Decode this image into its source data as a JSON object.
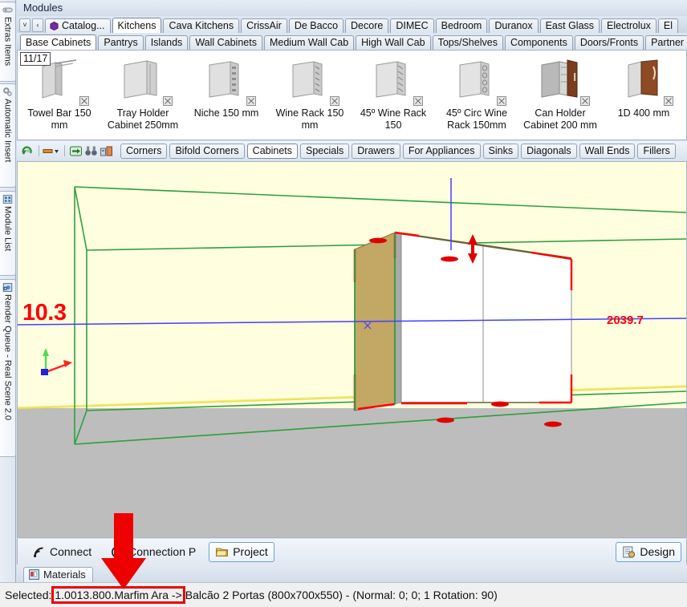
{
  "window": {
    "title": "Modules"
  },
  "left_dock": {
    "items": [
      {
        "label": "Extras Items",
        "icon": "capsule-icon"
      },
      {
        "label": "Automatic Insert",
        "icon": "gears-icon"
      },
      {
        "label": "Module List",
        "icon": "list-icon"
      },
      {
        "label": "Render Queue - Real Scene 2.0",
        "icon": "render-icon"
      }
    ]
  },
  "brand_tabs": {
    "nav_down": "˅",
    "nav_left": "‹",
    "catalog_label": "Catalog...",
    "items": [
      {
        "label": "Kitchens",
        "active": true
      },
      {
        "label": "Cava Kitchens",
        "active": false
      },
      {
        "label": "CrissAir",
        "active": false
      },
      {
        "label": "De Bacco",
        "active": false
      },
      {
        "label": "Decore",
        "active": false
      },
      {
        "label": "DIMEC",
        "active": false
      },
      {
        "label": "Bedroom",
        "active": false
      },
      {
        "label": "Duranox",
        "active": false
      },
      {
        "label": "East Glass",
        "active": false
      },
      {
        "label": "Electrolux",
        "active": false
      },
      {
        "label": "El",
        "active": false
      }
    ]
  },
  "category_tabs": {
    "items": [
      {
        "label": "Base Cabinets",
        "active": true
      },
      {
        "label": "Pantrys",
        "active": false
      },
      {
        "label": "Islands",
        "active": false
      },
      {
        "label": "Wall Cabinets",
        "active": false
      },
      {
        "label": "Medium Wall Cab",
        "active": false
      },
      {
        "label": "High Wall Cab",
        "active": false
      },
      {
        "label": "Tops/Shelves",
        "active": false
      },
      {
        "label": "Components",
        "active": false
      },
      {
        "label": "Doors/Fronts",
        "active": false
      },
      {
        "label": "Partner",
        "active": false
      }
    ]
  },
  "palette": {
    "page_badge": "11/17",
    "items": [
      {
        "caption": "Towel Bar 150 mm",
        "style": "towelbar"
      },
      {
        "caption": "Tray Holder Cabinet 250mm",
        "style": "tray"
      },
      {
        "caption": "Niche 150 mm",
        "style": "niche"
      },
      {
        "caption": "Wine Rack 150 mm",
        "style": "winerack"
      },
      {
        "caption": "45º Wine Rack 150",
        "style": "winerack45"
      },
      {
        "caption": "45º Circ Wine Rack 150mm",
        "style": "circwine"
      },
      {
        "caption": "Can Holder Cabinet 200 mm",
        "style": "canholder"
      },
      {
        "caption": "1D 400 mm",
        "style": "door400"
      }
    ]
  },
  "subtoolbar": {
    "icons": [
      {
        "name": "refresh-catalog-icon"
      },
      {
        "name": "color-swatch-dropdown-icon"
      },
      {
        "name": "insert-arrow-icon"
      },
      {
        "name": "find-binoculars-icon"
      },
      {
        "name": "compare-items-icon"
      }
    ],
    "tabs": [
      {
        "label": "Corners",
        "active": false
      },
      {
        "label": "Bifold Corners",
        "active": false
      },
      {
        "label": "Cabinets",
        "active": true
      },
      {
        "label": "Specials",
        "active": false
      },
      {
        "label": "Drawers",
        "active": false
      },
      {
        "label": "For Appliances",
        "active": false
      },
      {
        "label": "Sinks",
        "active": false
      },
      {
        "label": "Diagonals",
        "active": false
      },
      {
        "label": "Wall Ends",
        "active": false
      },
      {
        "label": "Fillers",
        "active": false
      }
    ]
  },
  "viewport": {
    "dimension_left": "10.3",
    "dimension_right": "2039.7",
    "sky_color": "#ffffe0",
    "floor_color": "#bdbdbd",
    "room_wireframe_color": "#2f9e3f",
    "selection_color": "#ff0000",
    "axis_color": "#4040ff",
    "cabinet_side_color": "#c2a765",
    "cabinet_front_color": "#ffffff"
  },
  "bottom_bar": {
    "buttons": [
      {
        "label": "Connect",
        "icon": "connect-icon",
        "boxed": false
      },
      {
        "label": "Connection P",
        "icon": "connection-point-icon",
        "boxed": false
      },
      {
        "label": "Project",
        "icon": "folder-icon",
        "boxed": true
      }
    ],
    "right_button": {
      "label": "Design",
      "icon": "design-icon"
    }
  },
  "lower_tabs": {
    "items": [
      {
        "label": "Materials",
        "icon": "materials-icon",
        "active": true
      }
    ]
  },
  "status_bar": {
    "prefix": "Selected:",
    "highlighted": "1.0013.800.Marfim Ara ->",
    "suffix": "Balcão 2 Portas (800x700x550) - (Normal: 0; 0; 1 Rotation: 90)"
  },
  "annotations": {
    "arrow_color": "#ee0000",
    "box_color": "#ee0000"
  }
}
